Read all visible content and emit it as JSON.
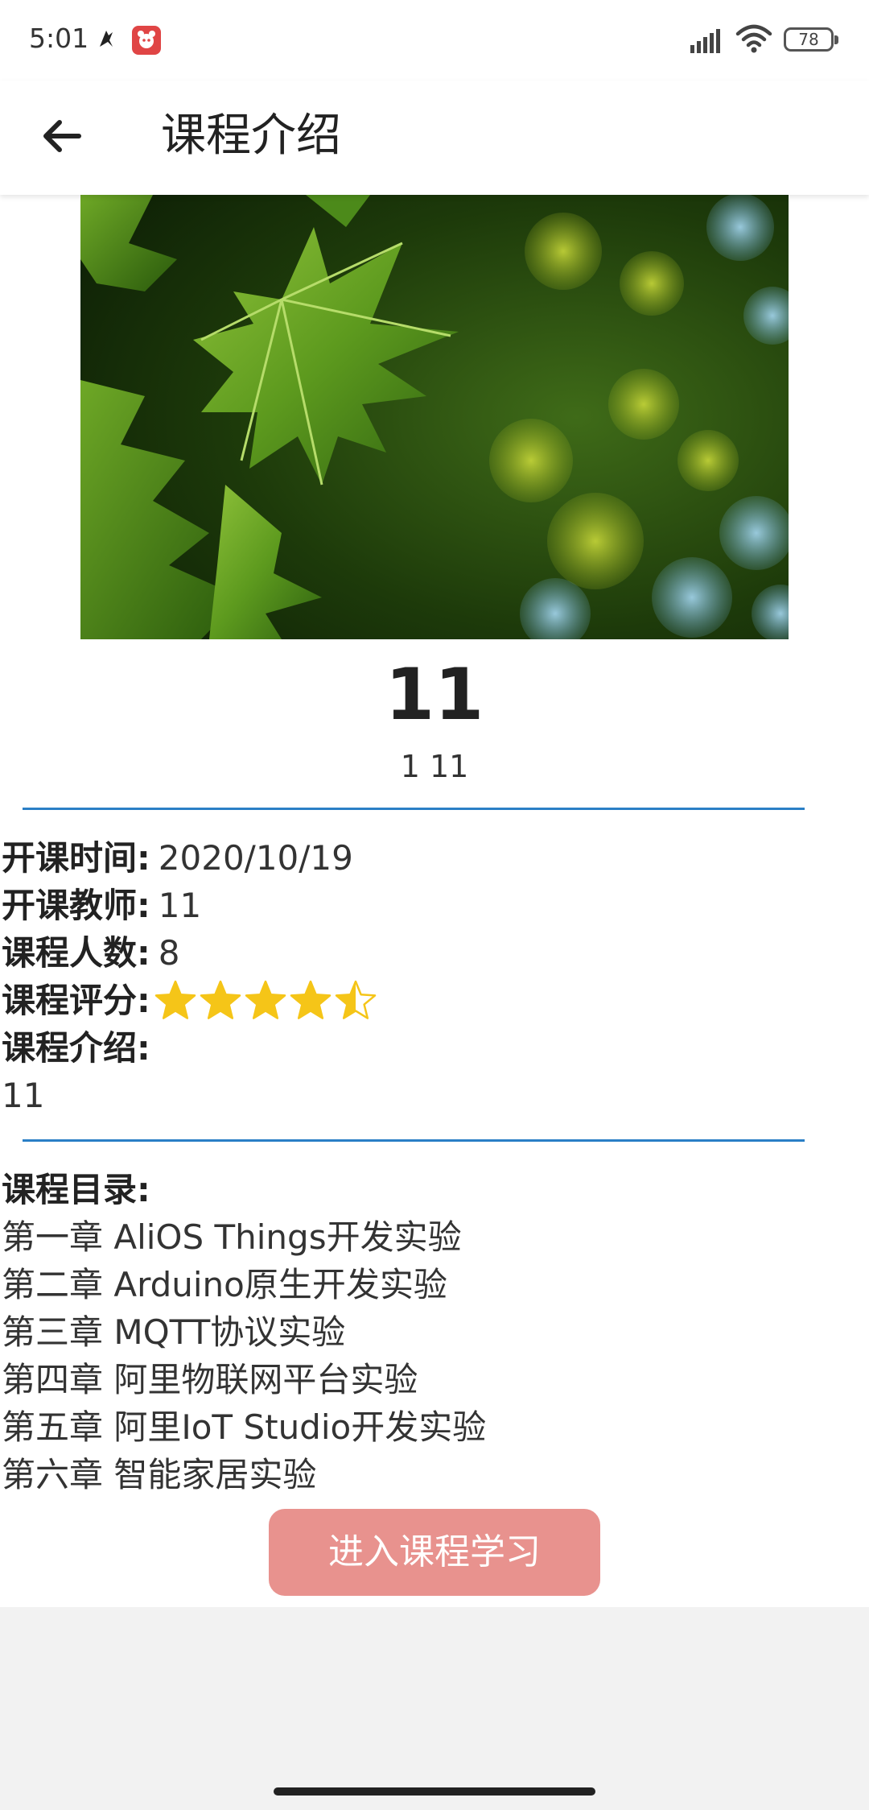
{
  "status_bar": {
    "time": "5:01",
    "battery": "78"
  },
  "app_bar": {
    "title": "课程介绍",
    "back_icon": "arrow-left-icon"
  },
  "course": {
    "title": "11",
    "subtitle": "1 11"
  },
  "info": {
    "start_time_label": "开课时间:",
    "start_time_value": "2020/10/19",
    "teacher_label": "开课教师:",
    "teacher_value": "11",
    "students_label": "课程人数:",
    "students_value": "8",
    "rating_label": "课程评分:",
    "rating_value": 4.5,
    "rating_max": 5,
    "intro_label": "课程介绍:",
    "intro_value": "11"
  },
  "catalog": {
    "label": "课程目录:",
    "chapters": [
      "第一章 AliOS Things开发实验",
      "第二章 Arduino原生开发实验",
      "第三章 MQTT协议实验",
      "第四章 阿里物联网平台实验",
      "第五章 阿里IoT Studio开发实验",
      "第六章 智能家居实验"
    ]
  },
  "enter_button": {
    "label": "进入课程学习"
  },
  "colors": {
    "divider": "#2a7fc6",
    "button": "#e8928e",
    "star": "#f5c518"
  }
}
